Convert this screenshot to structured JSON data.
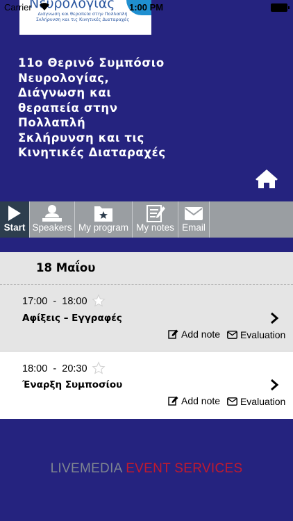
{
  "status_bar": {
    "carrier": "Carrier",
    "time": "1:00 PM"
  },
  "banner": {
    "title": "Νευρολογίας",
    "subtitle": "Διάγνωση και θεραπεία στην Πολλαπλή Σκλήρυνση και τις Κινητικές Διαταραχές"
  },
  "event": {
    "title_lines": [
      "11ο Θερινό Συμπόσιο",
      "Νευρολογίας,",
      "Διάγνωση και",
      "θεραπεία στην",
      "Πολλαπλή",
      "Σκλήρυνση και τις",
      "Κινητικές Διαταραχές"
    ]
  },
  "tabs": [
    {
      "label": "Start",
      "icon": "play-icon"
    },
    {
      "label": "Speakers",
      "icon": "speaker-icon"
    },
    {
      "label": "My program",
      "icon": "folder-star-icon"
    },
    {
      "label": "My notes",
      "icon": "notes-icon"
    },
    {
      "label": "Email",
      "icon": "envelope-icon"
    }
  ],
  "schedule": {
    "day": "18 Μαΐου",
    "sessions": [
      {
        "start": "17:00",
        "end": "18:00",
        "title": "Αφίξεις – Εγγραφές",
        "add_note": "Add note",
        "evaluation": "Evaluation"
      },
      {
        "start": "18:00",
        "end": "20:30",
        "title": "Έναρξη Συμποσίου",
        "add_note": "Add note",
        "evaluation": "Evaluation"
      }
    ]
  },
  "footer": {
    "part1": "LIVEMEDIA",
    "part2": "EVENT SERVICES"
  },
  "colors": {
    "background": "#25237f",
    "tabbar": "#9a9ea2",
    "active_tab": "#2d3e4e",
    "footer_accent": "#c21a2d"
  }
}
